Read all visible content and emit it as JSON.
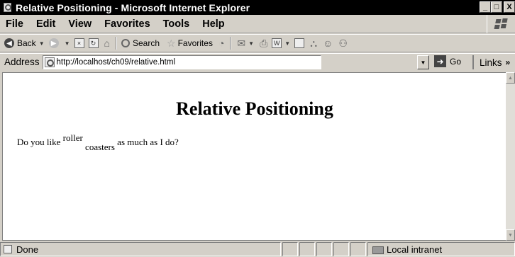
{
  "window": {
    "title": "Relative Positioning - Microsoft Internet Explorer",
    "buttons": {
      "minimize": "_",
      "maximize": "□",
      "close": "X"
    }
  },
  "menu": [
    "File",
    "Edit",
    "View",
    "Favorites",
    "Tools",
    "Help"
  ],
  "toolbar": {
    "back_label": "Back",
    "search_label": "Search",
    "favorites_label": "Favorites"
  },
  "address": {
    "label": "Address",
    "url": "http://localhost/ch09/relative.html",
    "go_label": "Go",
    "links_label": "Links"
  },
  "page": {
    "heading": "Relative Positioning",
    "text_before": "Do you like",
    "raised": "roller",
    "lowered": "coasters",
    "text_after": "as much as I do?"
  },
  "status": {
    "text": "Done",
    "zone": "Local intranet"
  }
}
